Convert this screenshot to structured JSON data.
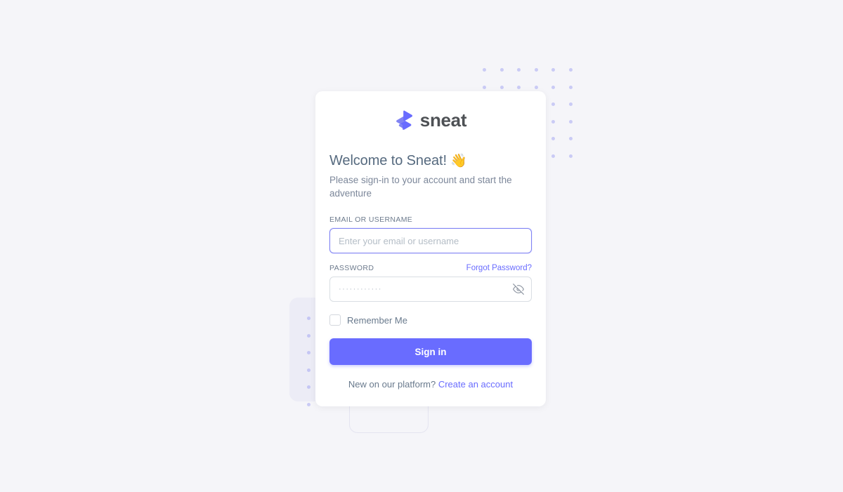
{
  "page": {
    "background_color": "#f5f5f9"
  },
  "brand": {
    "name": "sneat",
    "logo_icon": "sneat-s-logo-icon",
    "logo_color": "#696cff"
  },
  "card": {
    "title": "Welcome to Sneat!",
    "title_emoji": "👋",
    "subtitle": "Please sign-in to your account and start the adventure"
  },
  "form": {
    "email": {
      "label": "EMAIL OR USERNAME",
      "placeholder": "Enter your email or username",
      "value": "",
      "focused": true
    },
    "password": {
      "label": "PASSWORD",
      "forgot_label": "Forgot Password?",
      "placeholder": "············",
      "value": "",
      "toggle_icon": "eye-off-icon"
    },
    "remember": {
      "label": "Remember Me",
      "checked": false
    },
    "submit_label": "Sign in"
  },
  "footer": {
    "prompt": "New on our platform?",
    "link_label": "Create an account"
  },
  "colors": {
    "accent": "#696cff",
    "text_heading": "#566a7f",
    "text_body": "#697a8d",
    "border": "#d9dee3",
    "deco_dot": "#a5a8f3",
    "deco_block": "#ececf6"
  }
}
